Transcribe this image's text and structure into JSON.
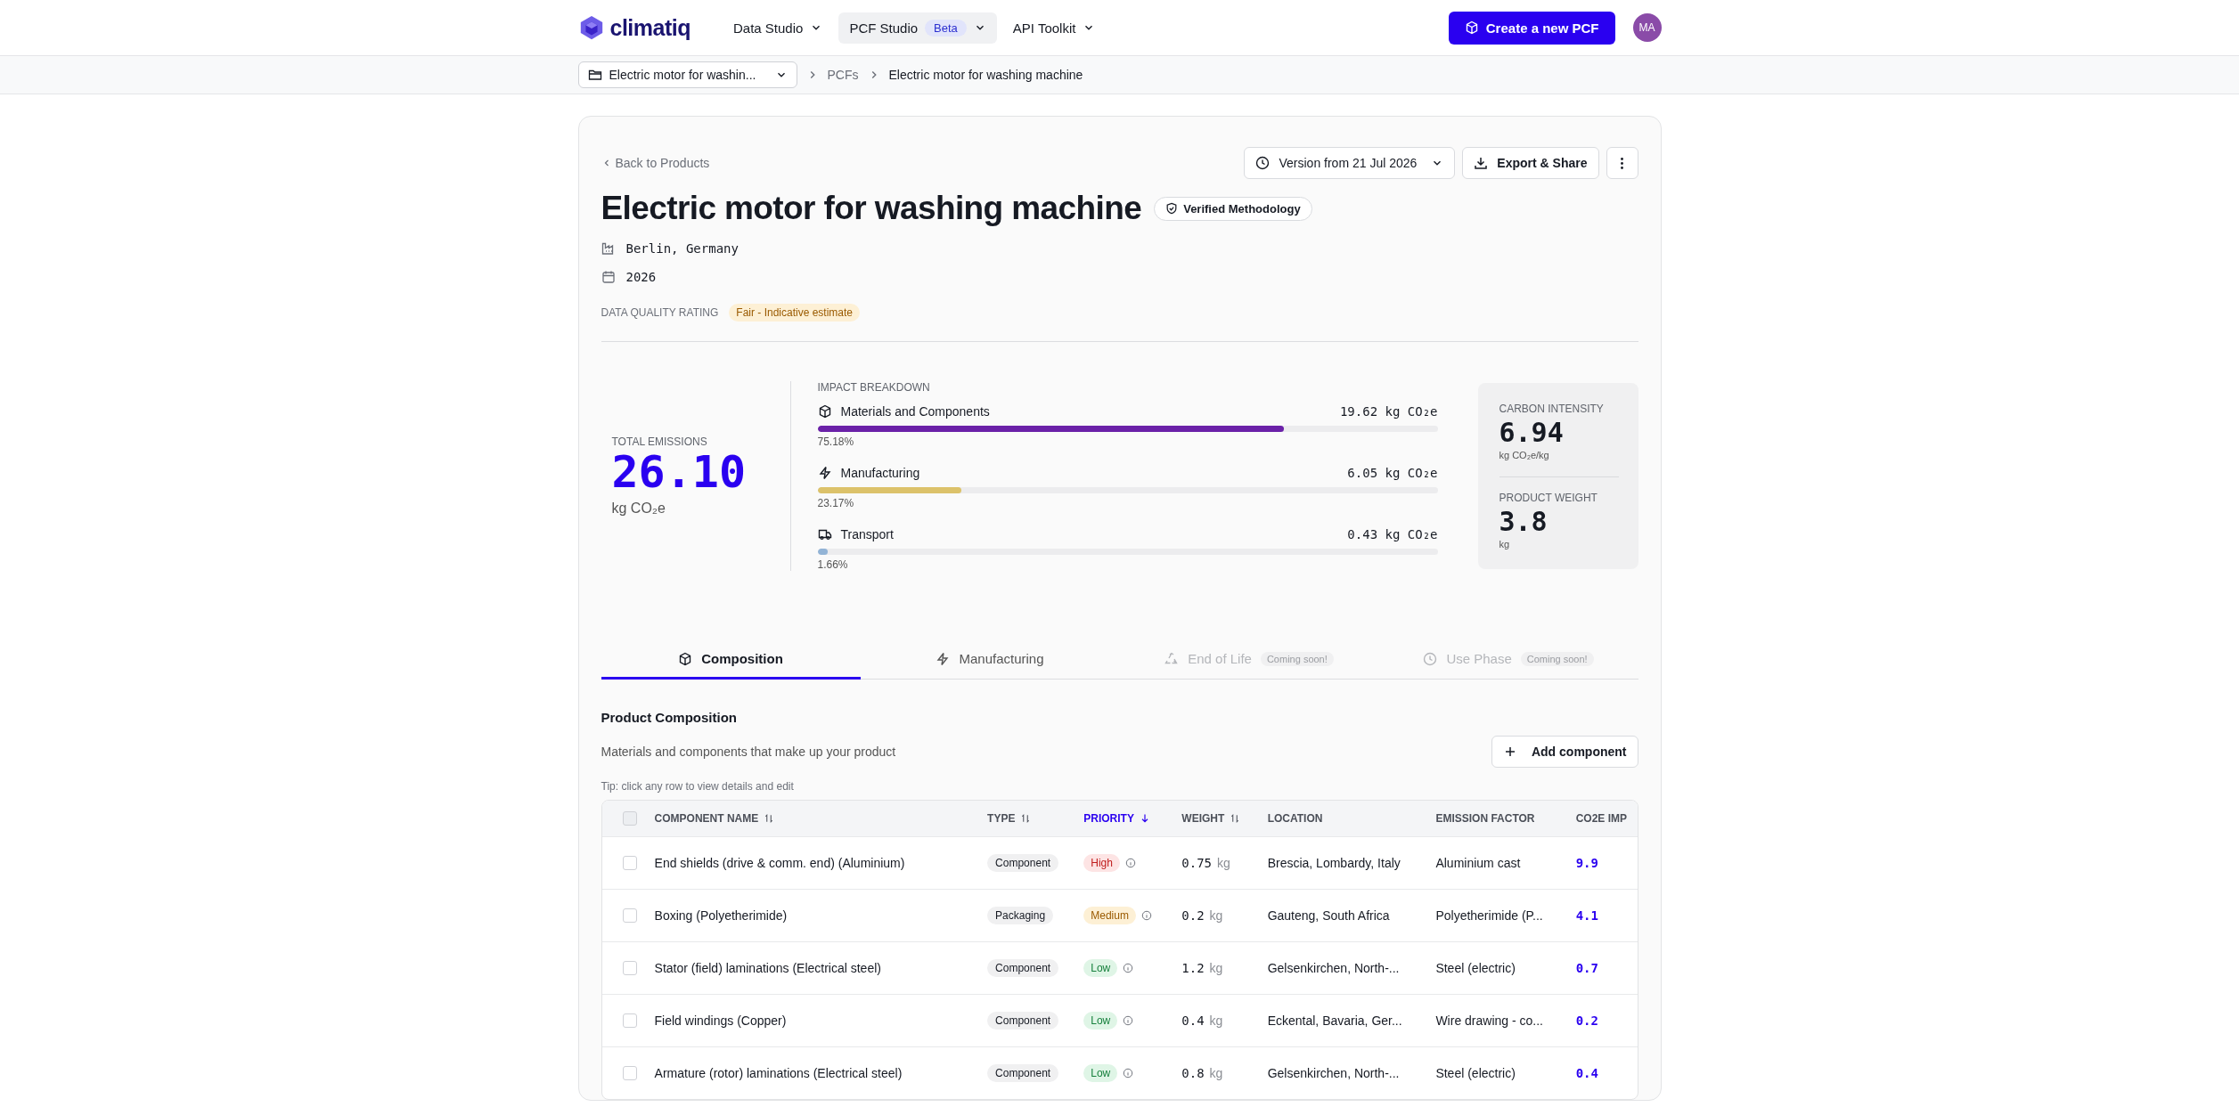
{
  "nav": {
    "logo": "climatiq",
    "menus": [
      {
        "label": "Data Studio",
        "selected": false
      },
      {
        "label": "PCF Studio",
        "badge": "Beta",
        "selected": true
      },
      {
        "label": "API Toolkit",
        "selected": false
      }
    ],
    "create_button": "Create a new PCF",
    "avatar": "MA"
  },
  "breadcrumb": {
    "dropdown": "Electric motor for washin...",
    "items": [
      "PCFs",
      "Electric motor for washing machine"
    ]
  },
  "header": {
    "back_link": "Back to Products",
    "version": "Version from 21 Jul 2026",
    "export_button": "Export & Share",
    "title": "Electric motor for washing machine",
    "verified_badge": "Verified Methodology",
    "location": "Berlin, Germany",
    "year": "2026",
    "quality_label": "DATA QUALITY RATING",
    "quality_value": "Fair - Indicative estimate"
  },
  "summary": {
    "total_label": "TOTAL EMISSIONS",
    "total_value": "26.10",
    "total_unit": "kg CO₂e",
    "breakdown_title": "IMPACT BREAKDOWN",
    "breakdown": [
      {
        "kind": "materials",
        "label": "Materials and Components",
        "value": "19.62 kg CO₂e",
        "percent": "75.18%",
        "level": 0.7518,
        "color": "#6b21a8"
      },
      {
        "kind": "manufacturing",
        "label": "Manufacturing",
        "value": "6.05 kg CO₂e",
        "percent": "23.17%",
        "level": 0.2317,
        "color": "#dcc26a"
      },
      {
        "kind": "transport",
        "label": "Transport",
        "value": "0.43 kg CO₂e",
        "percent": "1.66%",
        "level": 0.0166,
        "color": "#93b4d6"
      }
    ],
    "stats": [
      {
        "label": "CARBON INTENSITY",
        "value": "6.94",
        "unit": "kg CO₂e/kg"
      },
      {
        "label": "PRODUCT WEIGHT",
        "value": "3.8",
        "unit": "kg"
      }
    ]
  },
  "tabs": [
    {
      "kind": "composition",
      "label": "Composition",
      "selected": true,
      "disabled": false
    },
    {
      "kind": "manufacturing",
      "label": "Manufacturing",
      "selected": false,
      "disabled": false
    },
    {
      "kind": "end_of_life",
      "label": "End of Life",
      "selected": false,
      "disabled": true,
      "badge": "Coming soon!"
    },
    {
      "kind": "use_phase",
      "label": "Use Phase",
      "selected": false,
      "disabled": true,
      "badge": "Coming soon!"
    }
  ],
  "composition": {
    "title": "Product Composition",
    "subtitle": "Materials and components that make up your product",
    "add_button": "Add component",
    "tip": "Tip: click any row to view details and edit"
  },
  "table": {
    "select_all_checked": false,
    "columns": [
      {
        "label": "COMPONENT NAME",
        "sortable": true,
        "sorted": false
      },
      {
        "label": "TYPE",
        "sortable": true,
        "sorted": false
      },
      {
        "label": "PRIORITY",
        "sortable": true,
        "sorted": true
      },
      {
        "label": "WEIGHT",
        "sortable": true,
        "sorted": false
      },
      {
        "label": "LOCATION",
        "sortable": false,
        "sorted": false
      },
      {
        "label": "EMISSION FACTOR",
        "sortable": false,
        "sorted": false
      },
      {
        "label": "CO2E IMP",
        "sortable": false,
        "sorted": false
      }
    ],
    "rows": [
      {
        "checked": false,
        "name": "End shields (drive & comm. end) (Aluminium)",
        "type": "Component",
        "priority": {
          "kind": "high",
          "label": "High"
        },
        "weight": "0.75",
        "weight_unit": "kg",
        "location": "Brescia, Lombardy, Italy",
        "emission_factor": "Aluminium cast",
        "impact": "9.9"
      },
      {
        "checked": false,
        "name": "Boxing (Polyetherimide)",
        "type": "Packaging",
        "priority": {
          "kind": "medium",
          "label": "Medium"
        },
        "weight": "0.2",
        "weight_unit": "kg",
        "location": "Gauteng, South Africa",
        "emission_factor": "Polyetherimide (P...",
        "impact": "4.1"
      },
      {
        "checked": false,
        "name": "Stator (field) laminations (Electrical steel)",
        "type": "Component",
        "priority": {
          "kind": "low",
          "label": "Low"
        },
        "weight": "1.2",
        "weight_unit": "kg",
        "location": "Gelsenkirchen, North-...",
        "emission_factor": "Steel (electric)",
        "impact": "0.7"
      },
      {
        "checked": false,
        "name": "Field windings (Copper)",
        "type": "Component",
        "priority": {
          "kind": "low",
          "label": "Low"
        },
        "weight": "0.4",
        "weight_unit": "kg",
        "location": "Eckental, Bavaria, Ger...",
        "emission_factor": "Wire drawing - co...",
        "impact": "0.2"
      },
      {
        "checked": false,
        "name": "Armature (rotor) laminations (Electrical steel)",
        "type": "Component",
        "priority": {
          "kind": "low",
          "label": "Low"
        },
        "weight": "0.8",
        "weight_unit": "kg",
        "location": "Gelsenkirchen, North-...",
        "emission_factor": "Steel (electric)",
        "impact": "0.4"
      }
    ]
  }
}
